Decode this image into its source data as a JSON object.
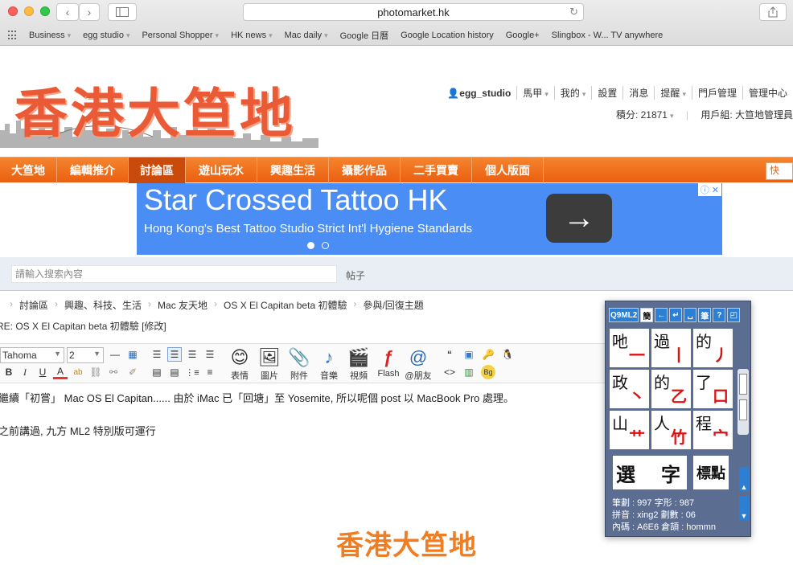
{
  "browser": {
    "url": "photomarket.hk",
    "back_label": "‹",
    "forward_label": "›",
    "bookmarks": [
      "Business",
      "egg studio",
      "Personal Shopper",
      "HK news",
      "Mac daily",
      "Google 日曆",
      "Google Location history",
      "Google+",
      "Slingbox - W... TV anywhere"
    ]
  },
  "site": {
    "logo": "香港大笪地",
    "user": {
      "username": "egg_studio",
      "links": [
        "馬甲",
        "我的",
        "設置",
        "消息",
        "提醒",
        "門戶管理",
        "管理中心"
      ],
      "credits": "積分: 21871",
      "group": "用戶組: 大笪地管理員"
    },
    "nav": [
      "大笪地",
      "編輯推介",
      "討論區",
      "遊山玩水",
      "興趣生活",
      "攝影作品",
      "二手買賣",
      "個人版面"
    ],
    "nav_right": "快"
  },
  "ad": {
    "title": "Star Crossed Tattoo HK",
    "subtitle": "Hong Kong's Best Tattoo Studio Strict Int'l Hygiene Standards",
    "arrow": "→",
    "badge": "ⓘ ✕"
  },
  "search": {
    "placeholder": "請輸入搜索內容",
    "scope": "帖子"
  },
  "breadcrumb": [
    "討論區",
    "興趣、科技、生活",
    "Mac 友天地",
    "OS X El Capitan beta 初體驗",
    "參與/回復主題"
  ],
  "reply_title": "RE: OS X El Capitan beta 初體驗 [修改]",
  "editor": {
    "font": "Tahoma",
    "size": "2",
    "tools": [
      {
        "icon": "smile-icon",
        "glyph": "😊",
        "label": "表情"
      },
      {
        "icon": "image-icon",
        "glyph": "🖼",
        "label": "圖片"
      },
      {
        "icon": "paperclip-icon",
        "glyph": "📎",
        "label": "附件"
      },
      {
        "icon": "music-icon",
        "glyph": "♪",
        "label": "音樂"
      },
      {
        "icon": "video-icon",
        "glyph": "🎬",
        "label": "視頻"
      },
      {
        "icon": "flash-icon",
        "glyph": "ƒ",
        "label": "Flash"
      },
      {
        "icon": "at-icon",
        "glyph": "@",
        "label": "@朋友"
      }
    ],
    "content": [
      "繼續「初嘗」 Mac OS El Capitan...... 由於 iMac 已「回塘」至 Yosemite,  所以呢個 post 以 MacBook Pro 處理。",
      "之前講過,  九方 ML2 特別版可運行"
    ]
  },
  "footer_logo": "香港大笪地",
  "ime": {
    "top_buttons": [
      "Q9ML2",
      "簡",
      "←",
      "↵",
      "␣",
      "筆",
      "?",
      "◰"
    ],
    "candidates": [
      {
        "char": "吔",
        "radical": "一"
      },
      {
        "char": "過",
        "radical": "丨"
      },
      {
        "char": "的",
        "radical": "丿"
      },
      {
        "char": "政",
        "radical": "丶"
      },
      {
        "char": "的",
        "radical": "乙"
      },
      {
        "char": "了",
        "radical": "口"
      },
      {
        "char": "山",
        "radical": "艹"
      },
      {
        "char": "人",
        "radical": "竹"
      },
      {
        "char": "程",
        "radical": "宀"
      }
    ],
    "select_label": "選　字",
    "punct_label": "標點",
    "info": [
      "筆劃 : 997 字形 : 987",
      "拼音 : xing2 劃數 : 06",
      "內碼 : A6E6 倉頡 : hommn"
    ]
  }
}
